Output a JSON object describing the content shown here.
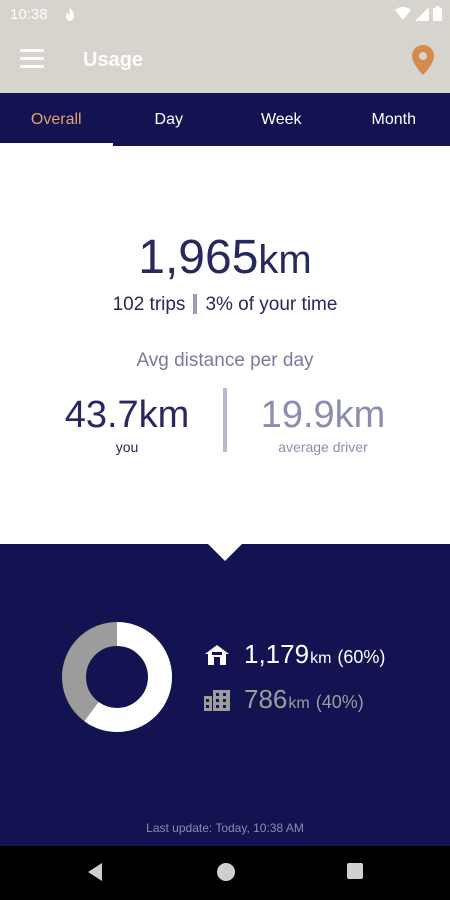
{
  "status_bar": {
    "time": "10:38"
  },
  "app_bar": {
    "title": "Usage"
  },
  "tabs": [
    {
      "label": "Overall",
      "active": true
    },
    {
      "label": "Day",
      "active": false
    },
    {
      "label": "Week",
      "active": false
    },
    {
      "label": "Month",
      "active": false
    }
  ],
  "summary": {
    "total_value": "1,965",
    "total_unit": "km",
    "trips": "102 trips",
    "time_share": "3% of your time",
    "avg_label": "Avg distance per day",
    "you_value": "43.7km",
    "you_label": "you",
    "driver_value": "19.9km",
    "driver_label": "average driver"
  },
  "breakdown": {
    "home": {
      "value": "1,179",
      "unit": "km",
      "percent": "(60%)",
      "share": 0.6,
      "color": "#ffffff",
      "icon": "home-icon"
    },
    "work": {
      "value": "786",
      "unit": "km",
      "percent": "(40%)",
      "share": 0.4,
      "color": "#9c9c9c",
      "icon": "office-building-icon"
    },
    "last_update": "Last update: Today, 10:38 AM"
  },
  "colors": {
    "navy": "#121350",
    "gray_bar": "#d7d3cd",
    "accent": "#e0a070"
  }
}
